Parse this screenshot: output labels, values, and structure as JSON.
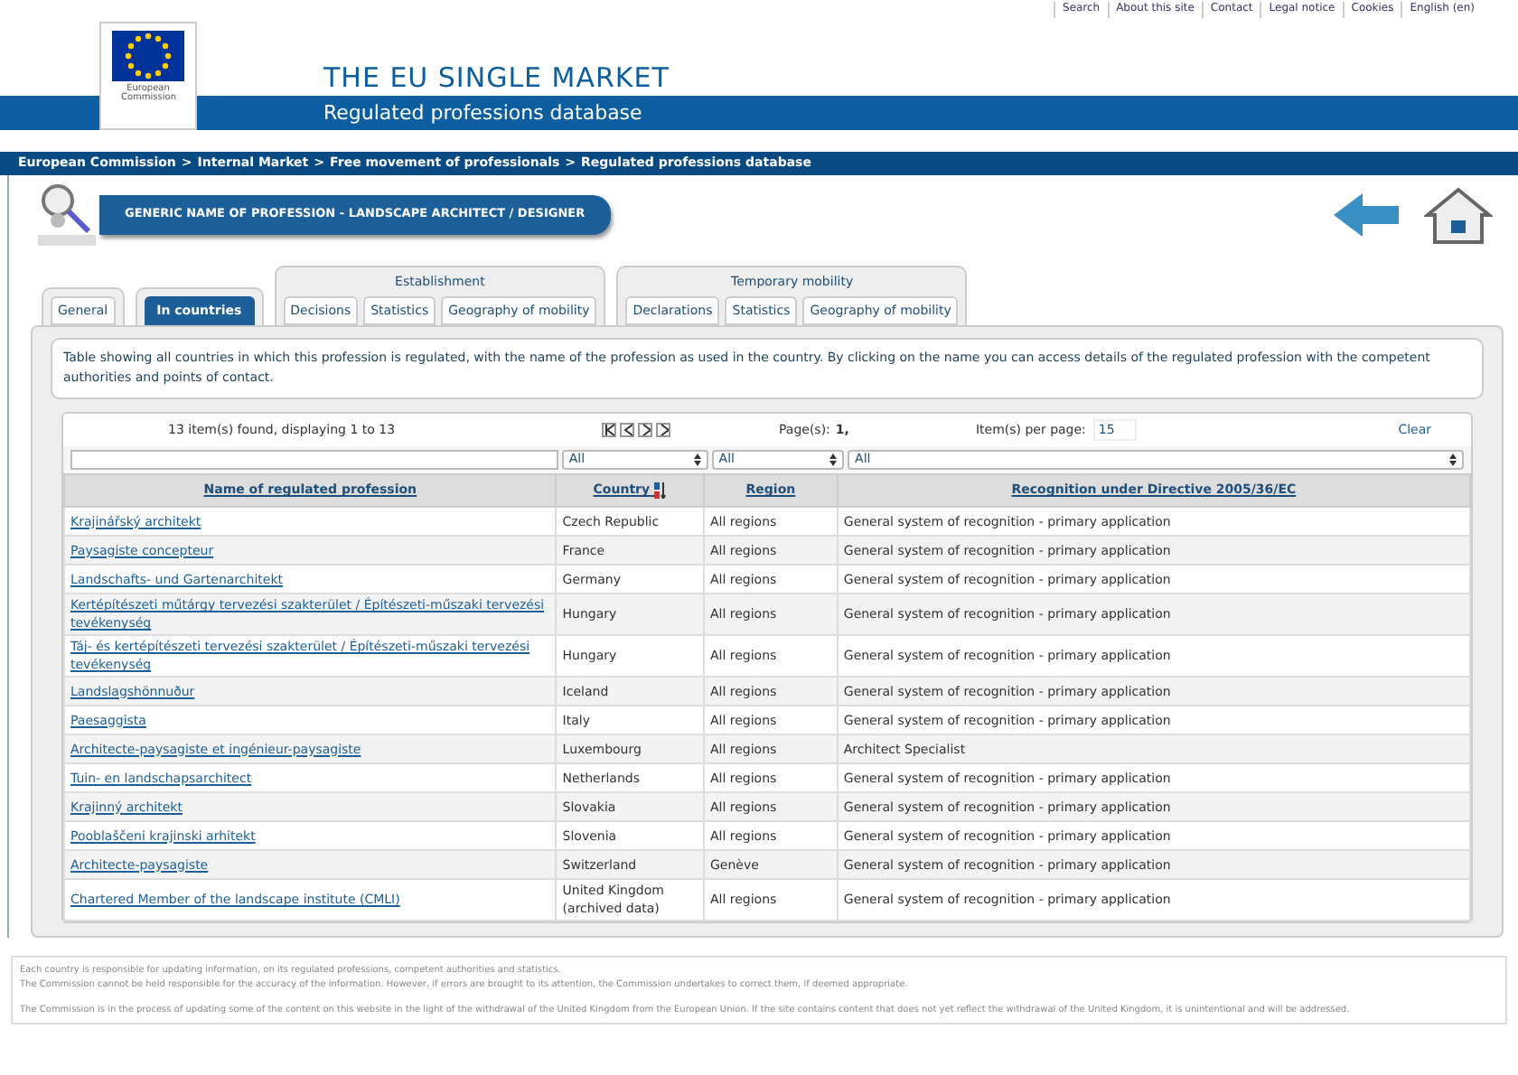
{
  "top_links": [
    "Search",
    "About this site",
    "Contact",
    "Legal notice",
    "Cookies",
    "English (en)"
  ],
  "header": {
    "logo_text": "European Commission",
    "title": "THE EU SINGLE MARKET",
    "subtitle": "Regulated professions database"
  },
  "breadcrumb_separator": ">",
  "breadcrumb": [
    "European Commission",
    "Internal Market",
    "Free movement of professionals",
    "Regulated professions database"
  ],
  "profession_title": "GENERIC NAME OF PROFESSION - LANDSCAPE ARCHITECT / DESIGNER",
  "tab_groups": [
    {
      "tabs": [
        {
          "label": "General",
          "selected": false
        }
      ]
    },
    {
      "tabs": [
        {
          "label": "In countries",
          "selected": true
        }
      ]
    },
    {
      "title": "Establishment",
      "tabs": [
        {
          "label": "Decisions",
          "selected": false
        },
        {
          "label": "Statistics",
          "selected": false
        },
        {
          "label": "Geography of mobility",
          "selected": false
        }
      ]
    },
    {
      "title": "Temporary mobility",
      "tabs": [
        {
          "label": "Declarations",
          "selected": false
        },
        {
          "label": "Statistics",
          "selected": false
        },
        {
          "label": "Geography of mobility",
          "selected": false
        }
      ]
    }
  ],
  "description": "Table showing all countries in which this profession is regulated, with the name of the profession as used in the country. By clicking on the name you can access details of the regulated profession with the competent authorities and points of contact.",
  "pager": {
    "found": "13 item(s) found, displaying 1 to 13",
    "pages_label": "Page(s):",
    "pages": "1,",
    "per_page_label": "Item(s) per page:",
    "per_page": "15",
    "clear": "Clear"
  },
  "filters": [
    "All",
    "All",
    "All"
  ],
  "table": {
    "columns": [
      "Name of regulated profession",
      "Country",
      "Region",
      "Recognition under Directive 2005/36/EC"
    ],
    "rows": [
      [
        "Krajinářský architekt",
        "Czech Republic",
        "All regions",
        "General system of recognition - primary application"
      ],
      [
        "Paysagiste concepteur",
        "France",
        "All regions",
        "General system of recognition - primary application"
      ],
      [
        "Landschafts- und Gartenarchitekt",
        "Germany",
        "All regions",
        "General system of recognition - primary application"
      ],
      [
        "Kertépítészeti műtárgy tervezési szakterület / Építészeti-műszaki tervezési tevékenység",
        "Hungary",
        "All regions",
        "General system of recognition - primary application"
      ],
      [
        "Táj- és kertépítészeti tervezési szakterület / Építészeti-műszaki tervezési tevékenység",
        "Hungary",
        "All regions",
        "General system of recognition - primary application"
      ],
      [
        "Landslagshönnuður",
        "Iceland",
        "All regions",
        "General system of recognition - primary application"
      ],
      [
        "Paesaggista",
        "Italy",
        "All regions",
        "General system of recognition - primary application"
      ],
      [
        "Architecte-paysagiste et ingénieur-paysagiste",
        "Luxembourg",
        "All regions",
        "Architect Specialist"
      ],
      [
        "Tuin- en landschapsarchitect",
        "Netherlands",
        "All regions",
        "General system of recognition - primary application"
      ],
      [
        "Krajinný architekt",
        "Slovakia",
        "All regions",
        "General system of recognition - primary application"
      ],
      [
        "Pooblaščeni krajinski arhitekt",
        "Slovenia",
        "All regions",
        "General system of recognition - primary application"
      ],
      [
        "Architecte-paysagiste",
        "Switzerland",
        "Genève",
        "General system of recognition - primary application"
      ],
      [
        "Chartered Member of the landscape institute (CMLI)",
        "United Kingdom (archived data)",
        "All regions",
        "General system of recognition - primary application"
      ]
    ]
  },
  "footer": [
    "Each country is responsible for updating information, on its regulated professions, competent authorities and statistics.",
    "The Commission cannot be held responsible for the accuracy of the information. However, if errors are brought to its attention, the Commission undertakes to correct them, if deemed appropriate.",
    "The Commission is in the process of updating some of the content on this website in the light of the withdrawal of the United Kingdom from the European Union. If the site contains content that does not yet reflect the withdrawal of the United Kingdom, it is unintentional and will be addressed."
  ]
}
